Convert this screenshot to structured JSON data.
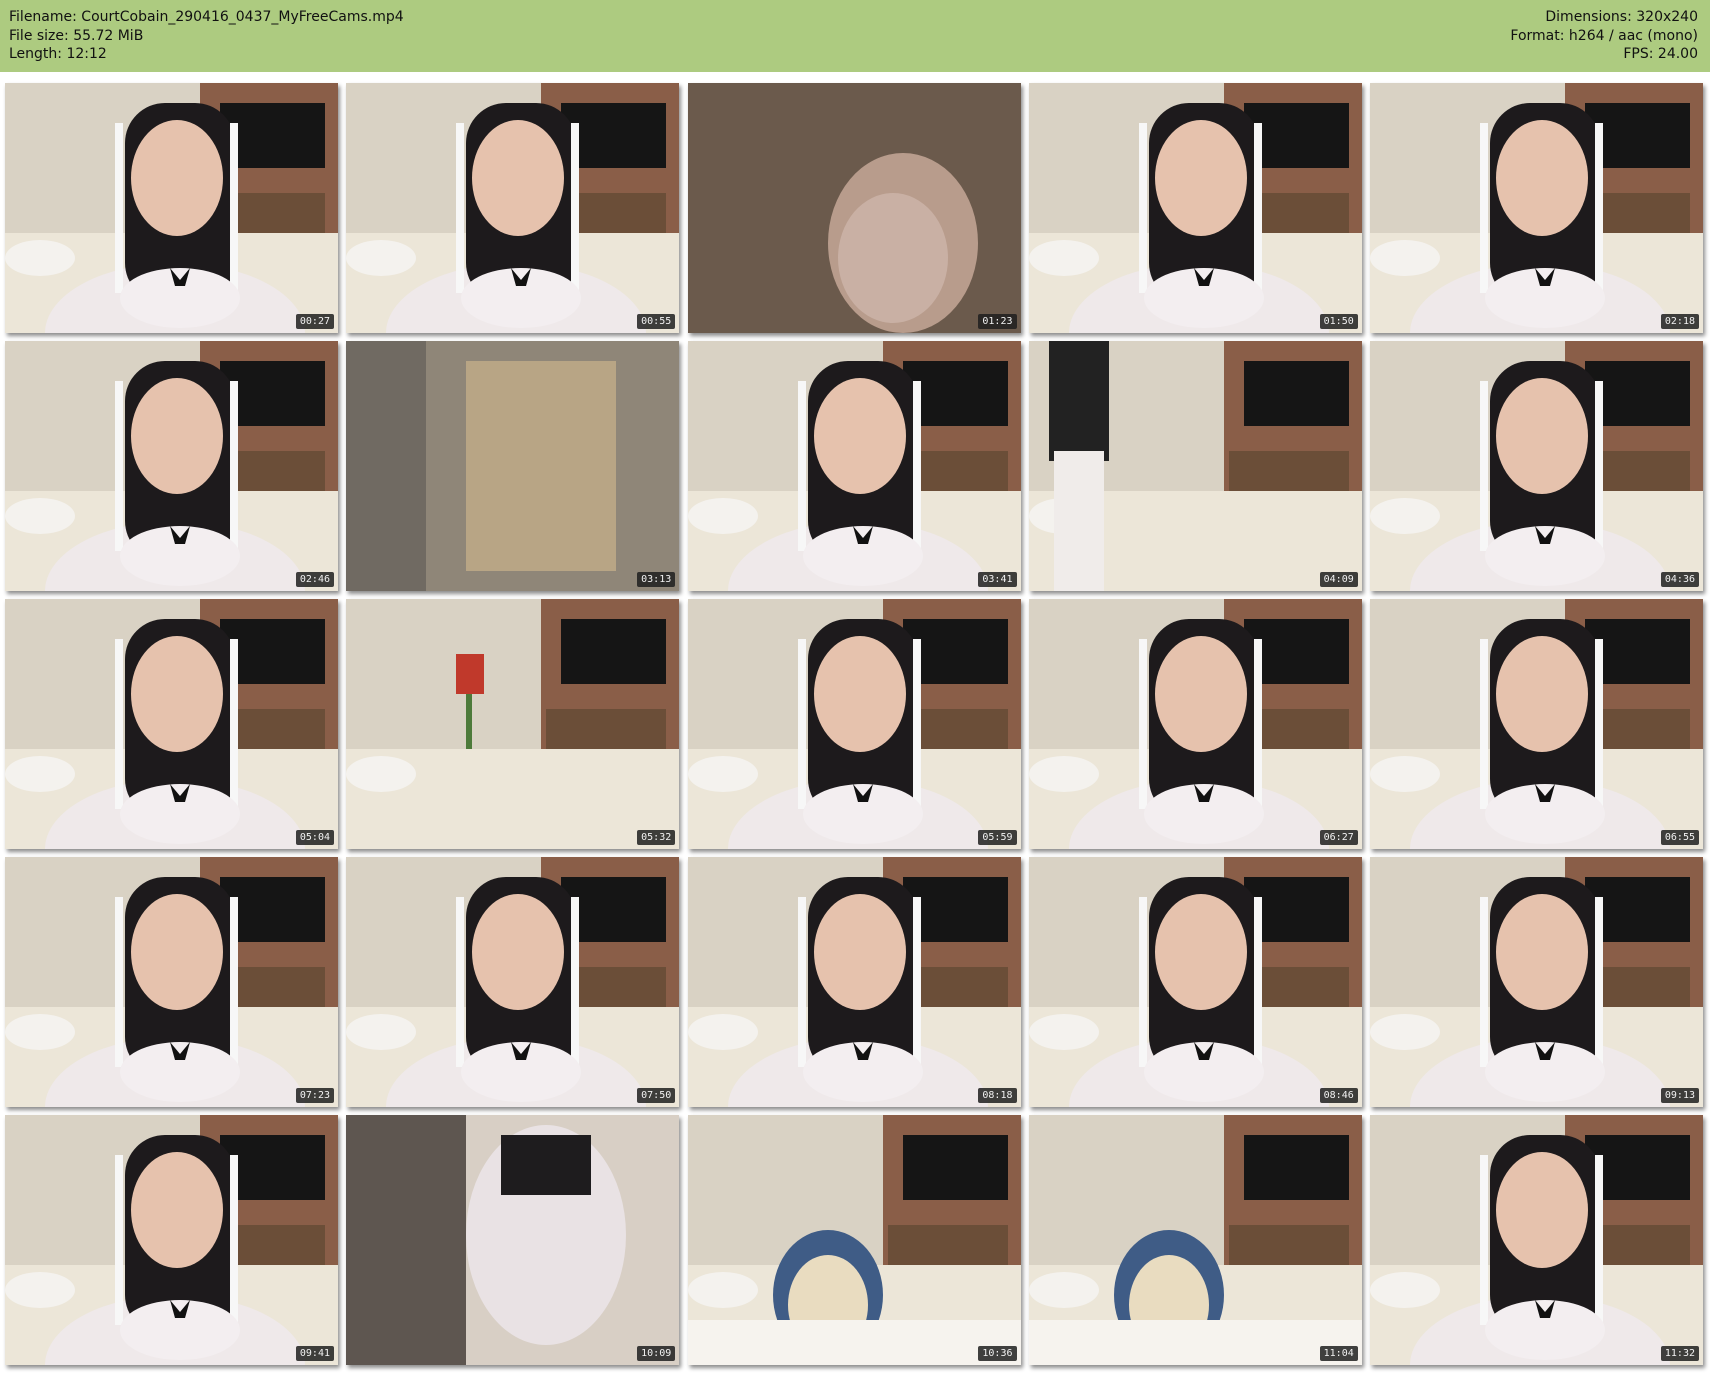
{
  "header": {
    "filename_label": "Filename: CourtCobain_290416_0437_MyFreeCams.mp4",
    "filesize_label": "File size: 55.72 MiB",
    "length_label": "Length: 12:12",
    "dimensions_label": "Dimensions: 320x240",
    "format_label": "Format: h264 / aac (mono)",
    "fps_label": "FPS: 24.00"
  },
  "colors": {
    "header_bg": "#adcb80",
    "brick": "#8a5e48",
    "wall": "#d9d2c4",
    "floor": "#ece6d8",
    "tv": "#151515",
    "hair": "#1d1a1c",
    "skin": "#e6c2ad"
  },
  "thumbnails": [
    {
      "time": "00:27",
      "scene": "closeup"
    },
    {
      "time": "00:55",
      "scene": "closeup"
    },
    {
      "time": "01:23",
      "scene": "blur-face"
    },
    {
      "time": "01:50",
      "scene": "closeup"
    },
    {
      "time": "02:18",
      "scene": "closeup"
    },
    {
      "time": "02:46",
      "scene": "closeup"
    },
    {
      "time": "03:13",
      "scene": "blur"
    },
    {
      "time": "03:41",
      "scene": "closeup"
    },
    {
      "time": "04:09",
      "scene": "standing"
    },
    {
      "time": "04:36",
      "scene": "closeup"
    },
    {
      "time": "05:04",
      "scene": "closeup"
    },
    {
      "time": "05:32",
      "scene": "room"
    },
    {
      "time": "05:59",
      "scene": "closeup"
    },
    {
      "time": "06:27",
      "scene": "closeup"
    },
    {
      "time": "06:55",
      "scene": "closeup"
    },
    {
      "time": "07:23",
      "scene": "closeup"
    },
    {
      "time": "07:50",
      "scene": "closeup"
    },
    {
      "time": "08:18",
      "scene": "closeup"
    },
    {
      "time": "08:46",
      "scene": "closeup"
    },
    {
      "time": "09:13",
      "scene": "closeup"
    },
    {
      "time": "09:41",
      "scene": "closeup"
    },
    {
      "time": "10:09",
      "scene": "blur-body"
    },
    {
      "time": "10:36",
      "scene": "plush"
    },
    {
      "time": "11:04",
      "scene": "plush"
    },
    {
      "time": "11:32",
      "scene": "closeup"
    }
  ]
}
